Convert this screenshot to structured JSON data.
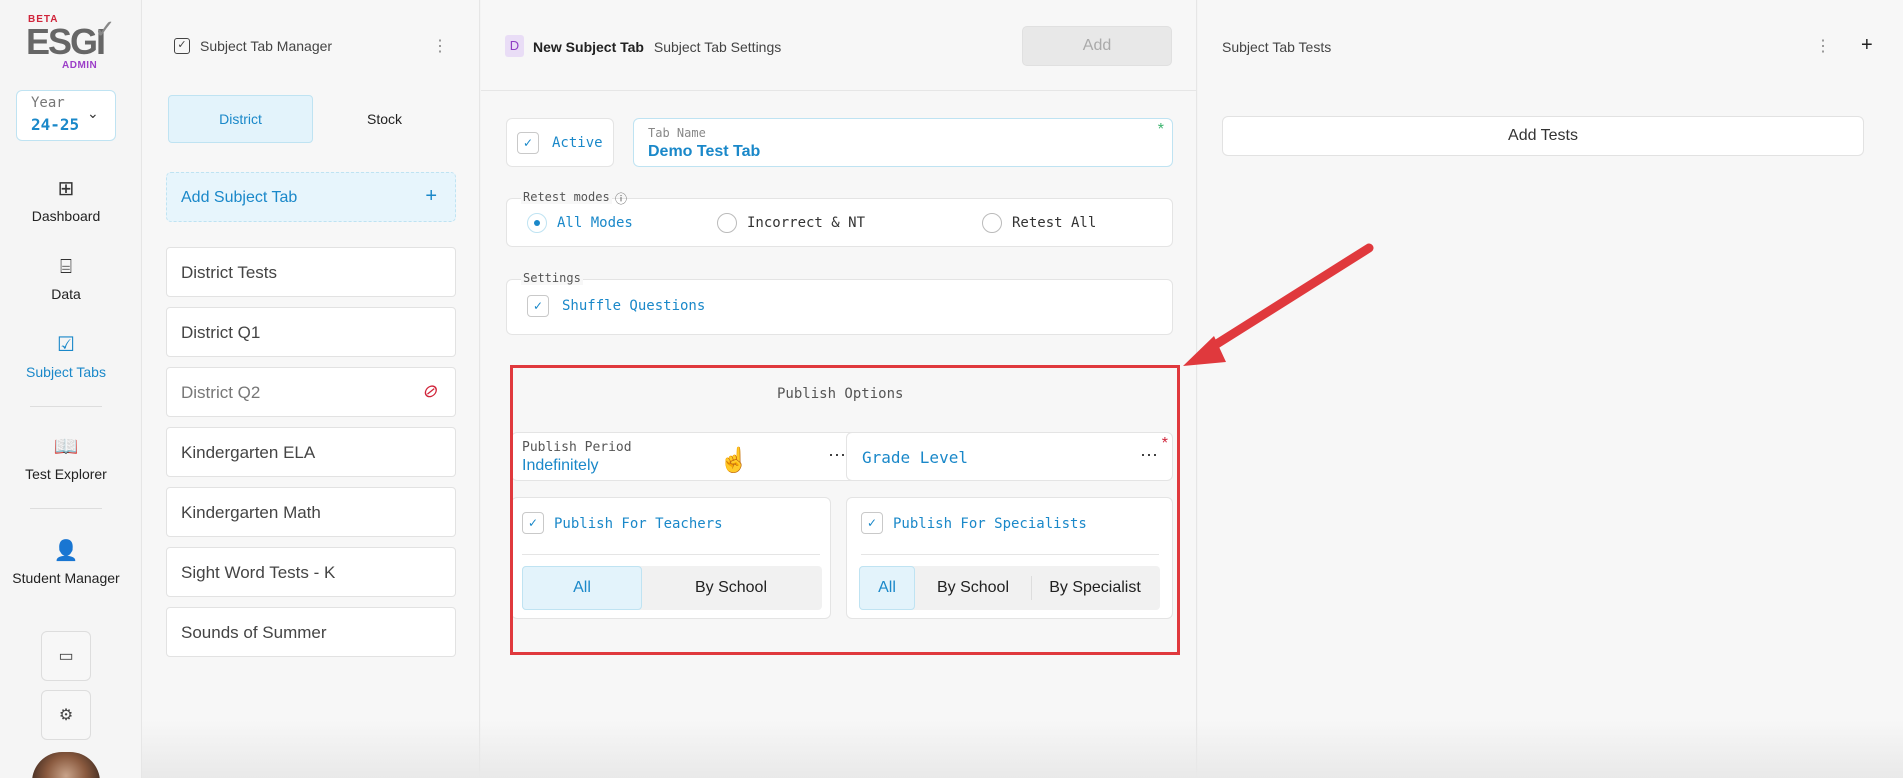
{
  "logo": {
    "beta": "BETA",
    "name": "ESGI",
    "admin": "ADMIN"
  },
  "year": {
    "label": "Year",
    "value": "24-25"
  },
  "nav": [
    {
      "label": "Dashboard",
      "icon": "dashboard-grid-icon"
    },
    {
      "label": "Data",
      "icon": "data-icon"
    },
    {
      "label": "Subject Tabs",
      "icon": "subject-tabs-icon"
    },
    {
      "label": "Test Explorer",
      "icon": "book-icon"
    },
    {
      "label": "Student Manager",
      "icon": "student-manager-icon"
    }
  ],
  "manager": {
    "title": "Subject Tab Manager",
    "tabs": [
      "District",
      "Stock"
    ],
    "add_label": "Add Subject Tab",
    "items": [
      "District Tests",
      "District Q1",
      "District Q2",
      "Kindergarten ELA",
      "Kindergarten Math",
      "Sight Word Tests - K",
      "Sounds of Summer"
    ]
  },
  "settings": {
    "badge": "D",
    "tab_title": "New Subject Tab",
    "subtitle": "Subject Tab Settings",
    "add_button": "Add",
    "active_label": "Active",
    "tab_name_label": "Tab Name",
    "tab_name_value": "Demo Test Tab",
    "retest_label": "Retest modes",
    "retest_options": [
      "All Modes",
      "Incorrect & NT",
      "Retest All"
    ],
    "settings_label": "Settings",
    "shuffle_label": "Shuffle Questions",
    "publish": {
      "title": "Publish Options",
      "period_label": "Publish Period",
      "period_value": "Indefinitely",
      "grade_label": "Grade Level",
      "teachers_label": "Publish For Teachers",
      "teachers_options": [
        "All",
        "By School"
      ],
      "specialists_label": "Publish For Specialists",
      "specialists_options": [
        "All",
        "By School",
        "By Specialist"
      ]
    }
  },
  "tests": {
    "title": "Subject Tab Tests",
    "add_label": "Add Tests"
  },
  "colors": {
    "accent": "#1a88c9",
    "highlight_frame": "#e0393d",
    "required_green": "#3cb46e",
    "required_red": "#d0243a"
  }
}
